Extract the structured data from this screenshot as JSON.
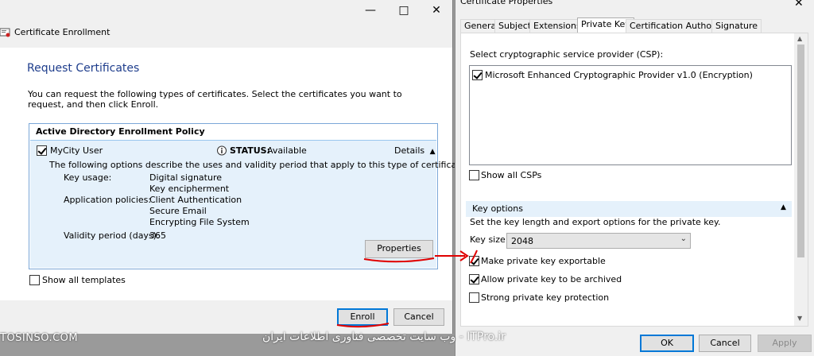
{
  "enrollment": {
    "window_title": "Certificate Enrollment",
    "heading": "Request Certificates",
    "intro": "You can request the following types of certificates. Select the certificates you want to request, and then click Enroll.",
    "policy_header": "Active Directory Enrollment Policy",
    "cert": {
      "name": "MyCity User",
      "checked": true,
      "status_label": "STATUS:",
      "status_value": "Available",
      "details_label": "Details",
      "description": "The following options describe the uses and validity period that apply to this type of certificate:",
      "key_usage_label": "Key usage:",
      "key_usage_values": [
        "Digital signature",
        "Key encipherment"
      ],
      "app_policies_label": "Application policies:",
      "app_policies_values": [
        "Client Authentication",
        "Secure Email",
        "Encrypting File System"
      ],
      "validity_label": "Validity period (days):",
      "validity_value": "365",
      "properties_button": "Properties"
    },
    "show_all_templates": "Show all templates",
    "enroll_button": "Enroll",
    "cancel_button": "Cancel"
  },
  "properties": {
    "window_title": "Certificate Properties",
    "tabs": [
      "General",
      "Subject",
      "Extensions",
      "Private Key",
      "Certification Authority",
      "Signature"
    ],
    "active_tab": "Private Key",
    "csp_label": "Select cryptographic service provider (CSP):",
    "csp_items": [
      {
        "label": "Microsoft Enhanced Cryptographic Provider v1.0 (Encryption)",
        "checked": true
      }
    ],
    "show_all_csps": "Show all CSPs",
    "key_options_title": "Key options",
    "key_options_desc": "Set the key length and export options for the private key.",
    "key_size_label": "Key size:",
    "key_size_value": "2048",
    "options": [
      {
        "label": "Make private key exportable",
        "checked": true
      },
      {
        "label": "Allow private key to be archived",
        "checked": true
      },
      {
        "label": "Strong private key protection",
        "checked": false
      }
    ],
    "ok_button": "OK",
    "cancel_button": "Cancel",
    "apply_button": "Apply"
  },
  "watermark": {
    "left": "TOSINSO.COM",
    "right": "ITPro.ir - وب سایت تخصصی فناوری اطلاعات ایران"
  },
  "colors": {
    "accent": "#0078d7",
    "heading": "#1e3d8c",
    "selection": "#e5f1fb",
    "annotation_red": "#e00000"
  }
}
